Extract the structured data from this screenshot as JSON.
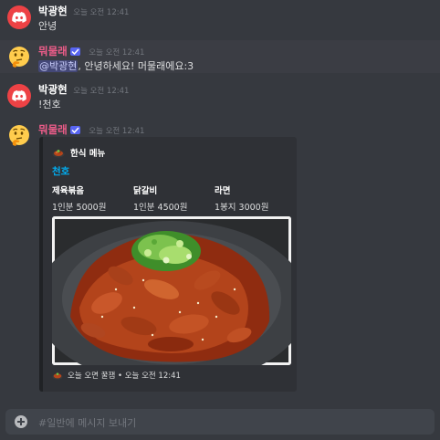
{
  "messages": [
    {
      "author": "박광현",
      "timestamp": "오늘 오전 12:41",
      "content": "안녕",
      "avatar": "discord-logo-icon"
    },
    {
      "author": "뭐물래",
      "author_color": "#ee5d8a",
      "badge": "bot-check-icon",
      "timestamp": "오늘 오전 12:41",
      "mention": "@박광현",
      "content": ", 안녕하세요! 머물래에요:3",
      "avatar": "thinking-face-icon"
    },
    {
      "author": "박광현",
      "timestamp": "오늘 오전 12:41",
      "content": "!천호",
      "avatar": "discord-logo-icon"
    },
    {
      "author": "뭐물래",
      "author_color": "#ee5d8a",
      "badge": "bot-check-icon",
      "timestamp": "오늘 오전 12:41",
      "avatar": "thinking-face-icon"
    }
  ],
  "embed": {
    "author_icon": "food-icon",
    "author": "한식 메뉴",
    "title": "천호",
    "title_color": "#00aff4",
    "fields": [
      {
        "name": "제육볶음",
        "value": "1인분 5000원"
      },
      {
        "name": "닭갈비",
        "value": "1인분 4500원"
      },
      {
        "name": "라면",
        "value": "1봉지 3000원"
      }
    ],
    "image": "spicy-pork-dish-photo",
    "footer_icon": "food-icon",
    "footer": "오늘 오면 꿀잼 • 오늘 오전 12:41"
  },
  "input": {
    "placeholder": "#일반에 메시지 보내기",
    "attach_icon": "plus-circle-icon"
  },
  "colors": {
    "background": "#36393f",
    "embed_bg": "#2f3136",
    "input_bg": "#40444b",
    "brand_red": "#ed4245",
    "blurple": "#5865f2"
  }
}
